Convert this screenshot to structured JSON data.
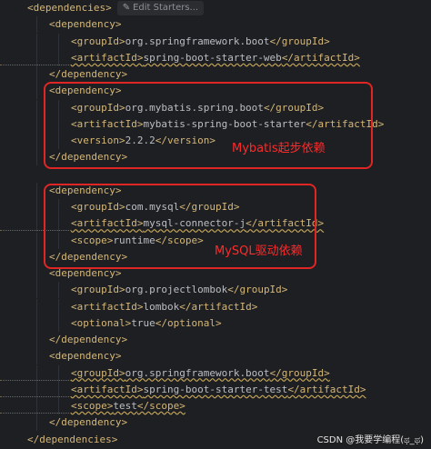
{
  "editor": {
    "lines": [
      {
        "indent": 1,
        "text": "<dependencies>",
        "hint": "Edit Starters..."
      },
      {
        "indent": 2,
        "text": "<dependency>"
      },
      {
        "indent": 3,
        "text": "<groupId>org.springframework.boot</groupId>"
      },
      {
        "indent": 3,
        "text": "<artifactId>spring-boot-starter-web</artifactId>"
      },
      {
        "indent": 2,
        "text": "</dependency>"
      },
      {
        "indent": 2,
        "text": "<dependency>"
      },
      {
        "indent": 3,
        "text": "<groupId>org.mybatis.spring.boot</groupId>"
      },
      {
        "indent": 3,
        "text": "<artifactId>mybatis-spring-boot-starter</artifactId>"
      },
      {
        "indent": 3,
        "text": "<version>2.2.2</version>"
      },
      {
        "indent": 2,
        "text": "</dependency>"
      },
      {
        "indent": 0,
        "text": ""
      },
      {
        "indent": 2,
        "text": "<dependency>"
      },
      {
        "indent": 3,
        "text": "<groupId>com.mysql</groupId>"
      },
      {
        "indent": 3,
        "text": "<artifactId>mysql-connector-j</artifactId>"
      },
      {
        "indent": 3,
        "text": "<scope>runtime</scope>"
      },
      {
        "indent": 2,
        "text": "</dependency>"
      },
      {
        "indent": 2,
        "text": "<dependency>"
      },
      {
        "indent": 3,
        "text": "<groupId>org.projectlombok</groupId>"
      },
      {
        "indent": 3,
        "text": "<artifactId>lombok</artifactId>"
      },
      {
        "indent": 3,
        "text": "<optional>true</optional>"
      },
      {
        "indent": 2,
        "text": "</dependency>"
      },
      {
        "indent": 2,
        "text": "<dependency>"
      },
      {
        "indent": 3,
        "text": "<groupId>org.springframework.boot</groupId>"
      },
      {
        "indent": 3,
        "text": "<artifactId>spring-boot-starter-test</artifactId>"
      },
      {
        "indent": 3,
        "text": "<scope>test</scope>"
      },
      {
        "indent": 2,
        "text": "</dependency>"
      },
      {
        "indent": 1,
        "text": "</dependencies>"
      }
    ]
  },
  "annotations": {
    "mybatis_note": "Mybatis起步依赖",
    "mysql_note": "MySQL驱动依赖"
  },
  "watermark": "CSDN @我要学编程(ಥ_ಥ)",
  "colors": {
    "background": "#1e1f22",
    "tag": "#d5b778",
    "text": "#bcbec4",
    "annotation": "#e02525"
  }
}
